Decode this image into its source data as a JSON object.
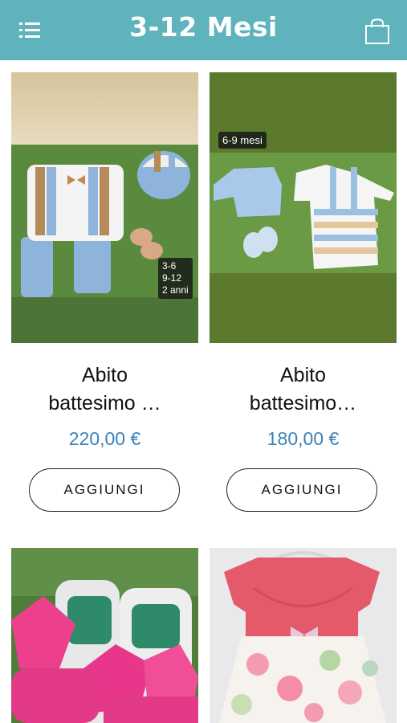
{
  "header": {
    "title": "3-12 Mesi",
    "menu_icon": "menu-icon",
    "bag_icon": "shopping-bag-icon"
  },
  "products": [
    {
      "name_line1": "Abito",
      "name_line2": "battesimo …",
      "price": "220,00 €",
      "button": "AGGIUNGI",
      "badge_lines": [
        "3-6",
        "9-12",
        "2 anni"
      ]
    },
    {
      "name_line1": "Abito",
      "name_line2": "battesimo…",
      "price": "180,00 €",
      "button": "AGGIUNGI",
      "badge": "6-9 mesi"
    },
    {
      "image": "pink-shoes"
    },
    {
      "image": "pink-floral-dress"
    }
  ],
  "colors": {
    "header": "#5fb3bd",
    "price": "#3a83b9"
  }
}
